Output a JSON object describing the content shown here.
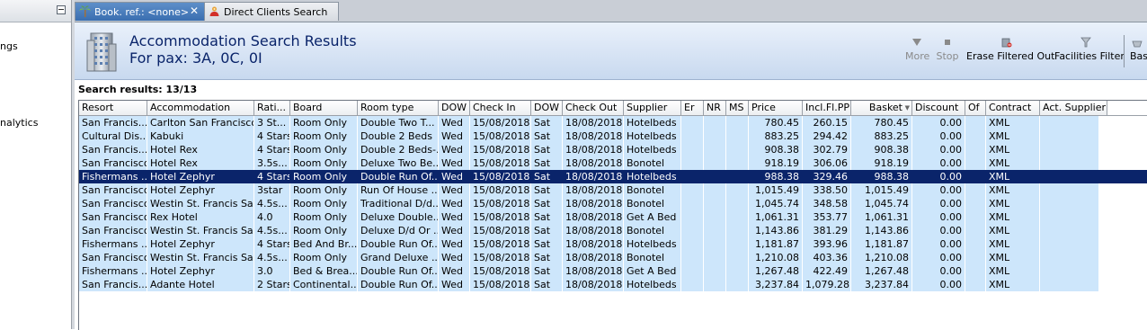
{
  "left_panel": {
    "items": [
      "ngs",
      "nalytics"
    ]
  },
  "tabs": [
    {
      "label": "Book. ref.: <none>",
      "active": true
    },
    {
      "label": "Direct Clients Search",
      "active": false
    }
  ],
  "header": {
    "title": "Accommodation Search Results",
    "subtitle": "For pax: 3A, 0C, 0I"
  },
  "toolbar": {
    "more": "More",
    "stop": "Stop",
    "erase": "Erase Filtered Out",
    "facilities": "Facilities Filter",
    "basket_partial": "Bas"
  },
  "results_label": "Search results: 13/13",
  "columns": [
    "Resort",
    "Accommodation",
    "Rati...",
    "Board",
    "Room type",
    "DOW",
    "Check In",
    "DOW",
    "Check Out",
    "Supplier",
    "Er",
    "NR",
    "MS",
    "Price",
    "Incl.Fl.PP",
    "Basket",
    "Discount",
    "Of",
    "Contract",
    "Act. Supplier"
  ],
  "rows": [
    [
      "San Francis...",
      "Carlton San Francisco",
      "3 St...",
      "Room Only",
      "Double Two T...",
      "Wed",
      "15/08/2018",
      "Sat",
      "18/08/2018",
      "Hotelbeds",
      "",
      "",
      "",
      "780.45",
      "260.15",
      "780.45",
      "0.00",
      "",
      "XML",
      ""
    ],
    [
      "Cultural Dis...",
      "Kabuki",
      "4 Stars",
      "Room Only",
      "Double 2 Beds",
      "Wed",
      "15/08/2018",
      "Sat",
      "18/08/2018",
      "Hotelbeds",
      "",
      "",
      "",
      "883.25",
      "294.42",
      "883.25",
      "0.00",
      "",
      "XML",
      ""
    ],
    [
      "San Francis...",
      "Hotel Rex",
      "4 Stars",
      "Room Only",
      "Double 2 Beds-...",
      "Wed",
      "15/08/2018",
      "Sat",
      "18/08/2018",
      "Hotelbeds",
      "",
      "",
      "",
      "908.38",
      "302.79",
      "908.38",
      "0.00",
      "",
      "XML",
      ""
    ],
    [
      "San Francisco",
      "Hotel Rex",
      "3.5s...",
      "Room Only",
      "Deluxe Two Be...",
      "Wed",
      "15/08/2018",
      "Sat",
      "18/08/2018",
      "Bonotel",
      "",
      "",
      "",
      "918.19",
      "306.06",
      "918.19",
      "0.00",
      "",
      "XML",
      ""
    ],
    [
      "Fishermans ...",
      "Hotel Zephyr",
      "4 Stars",
      "Room Only",
      "Double Run Of...",
      "Wed",
      "15/08/2018",
      "Sat",
      "18/08/2018",
      "Hotelbeds",
      "",
      "",
      "",
      "988.38",
      "329.46",
      "988.38",
      "0.00",
      "",
      "XML",
      ""
    ],
    [
      "San Francisco",
      "Hotel Zephyr",
      "3star",
      "Room Only",
      "Run Of House ...",
      "Wed",
      "15/08/2018",
      "Sat",
      "18/08/2018",
      "Bonotel",
      "",
      "",
      "",
      "1,015.49",
      "338.50",
      "1,015.49",
      "0.00",
      "",
      "XML",
      ""
    ],
    [
      "San Francisco",
      "Westin St. Francis Sa...",
      "4.5s...",
      "Room Only",
      "Traditional D/d...",
      "Wed",
      "15/08/2018",
      "Sat",
      "18/08/2018",
      "Bonotel",
      "",
      "",
      "",
      "1,045.74",
      "348.58",
      "1,045.74",
      "0.00",
      "",
      "XML",
      ""
    ],
    [
      "San Francisco",
      "Rex Hotel",
      "4.0",
      "Room Only",
      "Deluxe Double...",
      "Wed",
      "15/08/2018",
      "Sat",
      "18/08/2018",
      "Get A Bed",
      "",
      "",
      "",
      "1,061.31",
      "353.77",
      "1,061.31",
      "0.00",
      "",
      "XML",
      ""
    ],
    [
      "San Francisco",
      "Westin St. Francis Sa...",
      "4.5s...",
      "Room Only",
      "Deluxe D/d Or ...",
      "Wed",
      "15/08/2018",
      "Sat",
      "18/08/2018",
      "Bonotel",
      "",
      "",
      "",
      "1,143.86",
      "381.29",
      "1,143.86",
      "0.00",
      "",
      "XML",
      ""
    ],
    [
      "Fishermans ...",
      "Hotel Zephyr",
      "4 Stars",
      "Bed And Br...",
      "Double Run Of...",
      "Wed",
      "15/08/2018",
      "Sat",
      "18/08/2018",
      "Hotelbeds",
      "",
      "",
      "",
      "1,181.87",
      "393.96",
      "1,181.87",
      "0.00",
      "",
      "XML",
      ""
    ],
    [
      "San Francisco",
      "Westin St. Francis Sa...",
      "4.5s...",
      "Room Only",
      "Grand Deluxe ...",
      "Wed",
      "15/08/2018",
      "Sat",
      "18/08/2018",
      "Bonotel",
      "",
      "",
      "",
      "1,210.08",
      "403.36",
      "1,210.08",
      "0.00",
      "",
      "XML",
      ""
    ],
    [
      "Fishermans ...",
      "Hotel Zephyr",
      "3.0",
      "Bed & Brea...",
      "Double Run Of...",
      "Wed",
      "15/08/2018",
      "Sat",
      "18/08/2018",
      "Get A Bed",
      "",
      "",
      "",
      "1,267.48",
      "422.49",
      "1,267.48",
      "0.00",
      "",
      "XML",
      ""
    ],
    [
      "San Francis...",
      "Adante Hotel",
      "2 Stars",
      "Continental...",
      "Double Run Of...",
      "Wed",
      "15/08/2018",
      "Sat",
      "18/08/2018",
      "Hotelbeds",
      "",
      "",
      "",
      "3,237.84",
      "1,079.28",
      "3,237.84",
      "0.00",
      "",
      "XML",
      ""
    ]
  ],
  "selected_row": 4
}
